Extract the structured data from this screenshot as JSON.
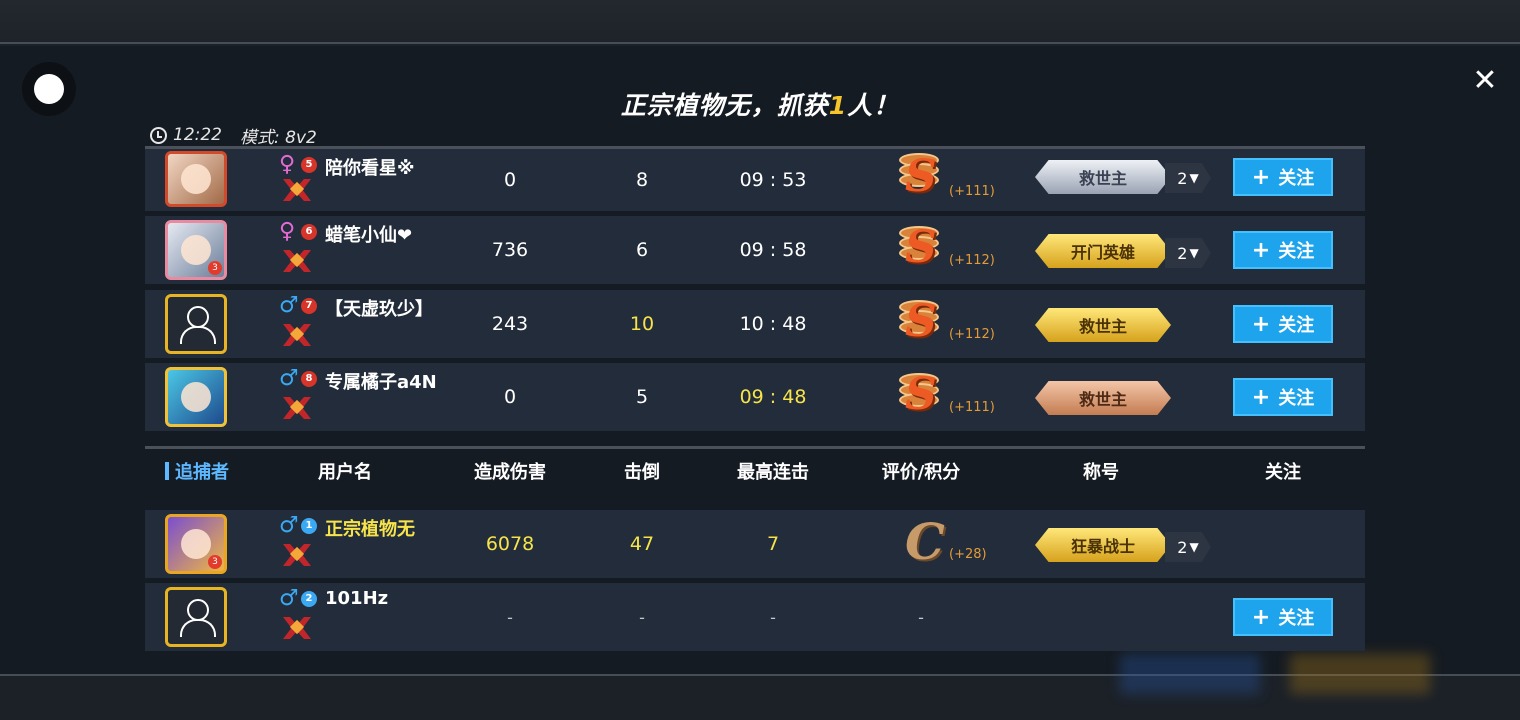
{
  "headline": {
    "prefix": "正宗植物无，抓获",
    "count": "1",
    "suffix": "人！"
  },
  "meta": {
    "time": "12:22",
    "mode": "模式: 8v2"
  },
  "runners": [
    {
      "rank": "5",
      "gender": "♀",
      "name": "陪你看星※",
      "damage": "0",
      "knockdowns": "8",
      "time": "09 : 53",
      "grade": "S",
      "points": "(+111)",
      "badge": "救世主",
      "badge_count": "2",
      "follow": "关注"
    },
    {
      "rank": "6",
      "gender": "♀",
      "name": "蜡笔小仙❤",
      "damage": "736",
      "knockdowns": "6",
      "time": "09 : 58",
      "grade": "S",
      "points": "(+112)",
      "badge": "开门英雄",
      "badge_count": "2",
      "follow": "关注"
    },
    {
      "rank": "7",
      "gender": "♂",
      "name": "【天虚玖少】",
      "damage": "243",
      "knockdowns": "10",
      "time": "10 : 48",
      "grade": "S",
      "points": "(+112)",
      "badge": "救世主",
      "follow": "关注"
    },
    {
      "rank": "8",
      "gender": "♂",
      "name": "专属橘子a4N",
      "damage": "0",
      "knockdowns": "5",
      "time": "09 : 48",
      "grade": "S",
      "points": "(+111)",
      "badge": "救世主",
      "follow": "关注"
    }
  ],
  "headers": {
    "role": "追捕者",
    "username": "用户名",
    "damage": "造成伤害",
    "knockdowns": "击倒",
    "combo": "最高连击",
    "score": "评价/积分",
    "title": "称号",
    "follow": "关注"
  },
  "hunters": [
    {
      "rank": "1",
      "gender": "♂",
      "name": "正宗植物无",
      "damage": "6078",
      "knockdowns": "47",
      "combo": "7",
      "grade": "C",
      "points": "(+28)",
      "badge": "狂暴战士",
      "badge_count": "2"
    },
    {
      "rank": "2",
      "gender": "♂",
      "name": "101Hz",
      "damage": "-",
      "knockdowns": "-",
      "combo": "-",
      "score": "-",
      "follow": "关注"
    }
  ],
  "avatar_levels": {
    "runner2": "3",
    "hunter1": "3"
  },
  "colors": {
    "accent_blue": "#1ea4ec",
    "highlight_yellow": "#f6e44a",
    "grade_orange": "#ee5a24"
  },
  "icons": {
    "record": "record-dot-icon",
    "close": "close-icon",
    "clock": "clock-icon"
  },
  "close_glyph": "✕"
}
